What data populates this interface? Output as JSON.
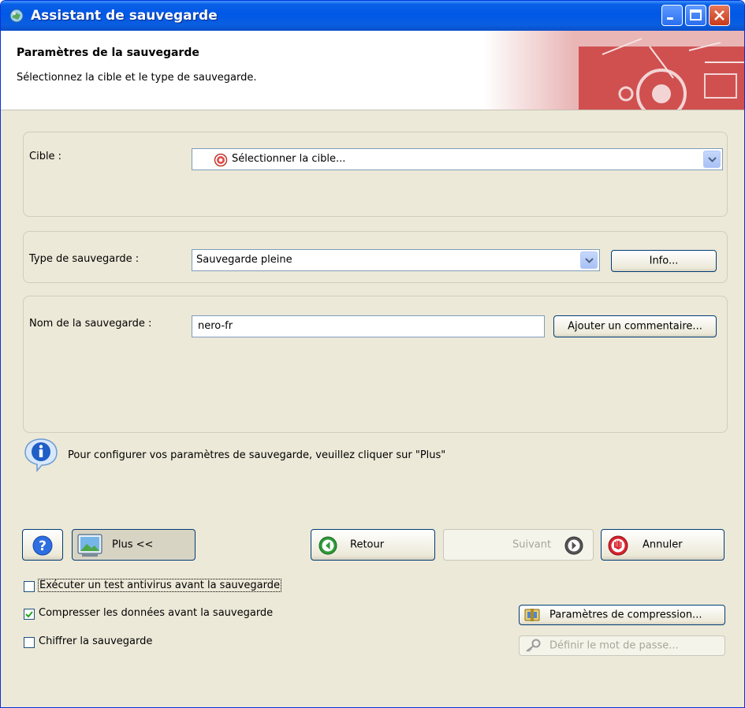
{
  "window": {
    "title": "Assistant de sauvegarde"
  },
  "header": {
    "title": "Paramètres de la sauvegarde",
    "subtitle": "Sélectionnez la cible et le type de sauvegarde."
  },
  "target": {
    "label": "Cible :",
    "value": "Sélectionner la cible..."
  },
  "backup_type": {
    "label": "Type de sauvegarde :",
    "value": "Sauvegarde pleine",
    "info_button": "Info..."
  },
  "backup_name": {
    "label": "Nom de la sauvegarde :",
    "value": "nero-fr",
    "comment_button": "Ajouter un commentaire..."
  },
  "info_message": "Pour configurer vos paramètres de sauvegarde, veuillez cliquer sur \"Plus\"",
  "nav": {
    "more_button": "Plus <<",
    "back_button": "Retour",
    "next_button": "Suivant",
    "cancel_button": "Annuler"
  },
  "options": {
    "antivirus": {
      "label": "Exécuter un test antivirus avant la sauvegarde",
      "checked": false
    },
    "compress": {
      "label": "Compresser les données avant la sauvegarde",
      "checked": true
    },
    "encrypt": {
      "label": "Chiffrer la sauvegarde",
      "checked": false
    },
    "compression_settings_button": "Paramètres de compression...",
    "password_button": "Définir le mot de passe..."
  },
  "colors": {
    "titlebar": "#0058e6",
    "dialog_bg": "#ece9d8",
    "accent_red": "#d9232e"
  }
}
